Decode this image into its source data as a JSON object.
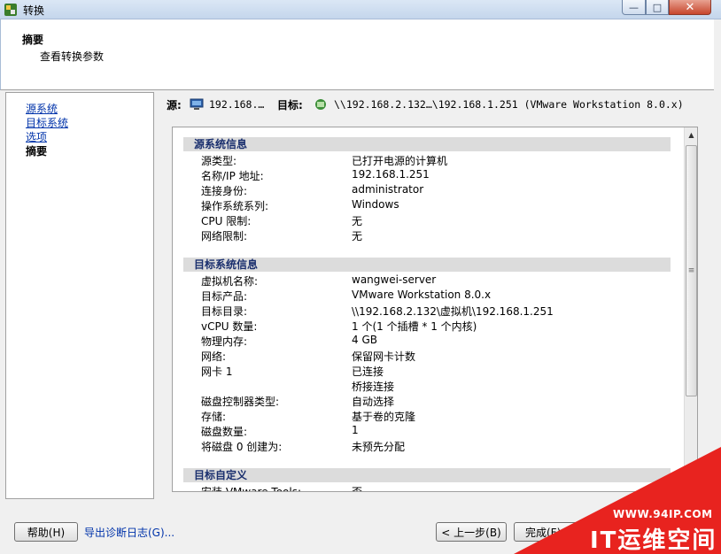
{
  "window": {
    "title": "转换",
    "controls": {
      "minimize": "—",
      "maximize": "□",
      "close": "✕"
    }
  },
  "header": {
    "title": "摘要",
    "subtitle": "查看转换参数"
  },
  "nav": {
    "items": [
      {
        "label": "源系统",
        "link": true
      },
      {
        "label": "目标系统",
        "link": true
      },
      {
        "label": "选项",
        "link": true
      },
      {
        "label": "摘要",
        "link": false
      }
    ]
  },
  "summary_bar": {
    "source_label": "源:",
    "source_value": "192.168.…",
    "target_label": "目标:",
    "target_value": "\\\\192.168.2.132…\\192.168.1.251 (VMware Workstation 8.0.x)"
  },
  "sections": [
    {
      "title": "源系统信息",
      "rows": [
        {
          "label": "源类型:",
          "value": "已打开电源的计算机"
        },
        {
          "label": "名称/IP 地址:",
          "value": "192.168.1.251"
        },
        {
          "label": "连接身份:",
          "value": "administrator"
        },
        {
          "label": "操作系统系列:",
          "value": "Windows"
        },
        {
          "label": "CPU 限制:",
          "value": "无"
        },
        {
          "label": "网络限制:",
          "value": "无"
        }
      ]
    },
    {
      "title": "目标系统信息",
      "rows": [
        {
          "label": "虚拟机名称:",
          "value": "wangwei-server"
        },
        {
          "label": "目标产品:",
          "value": "VMware Workstation 8.0.x"
        },
        {
          "label": "目标目录:",
          "value": "\\\\192.168.2.132\\虚拟机\\192.168.1.251"
        },
        {
          "label": "vCPU 数量:",
          "value": "1 个(1 个插槽 * 1 个内核)"
        },
        {
          "label": "物理内存:",
          "value": "4 GB"
        },
        {
          "label": "网络:",
          "value": "保留网卡计数"
        },
        {
          "label": "网卡 1",
          "value": "已连接"
        },
        {
          "label": "",
          "value": "桥接连接"
        },
        {
          "label": "磁盘控制器类型:",
          "value": "自动选择"
        },
        {
          "label": "存储:",
          "value": "基于卷的克隆"
        },
        {
          "label": "磁盘数量:",
          "value": "1"
        },
        {
          "label": "将磁盘 0 创建为:",
          "value": "未预先分配"
        }
      ]
    },
    {
      "title": "目标自定义",
      "rows": [
        {
          "label": "安装 VMware Tools:",
          "value": "否"
        }
      ]
    }
  ],
  "footer": {
    "help_button": "帮助(H)",
    "export_link": "导出诊断日志(G)...",
    "back_button": "< 上一步(B)",
    "finish_button": "完成(F)"
  },
  "watermark": {
    "site": "WWW.94IP.COM",
    "brand": "IT运维空间"
  },
  "colors": {
    "link": "#0033aa",
    "section_title": "#1a2f6e",
    "watermark": "#e8231f"
  }
}
